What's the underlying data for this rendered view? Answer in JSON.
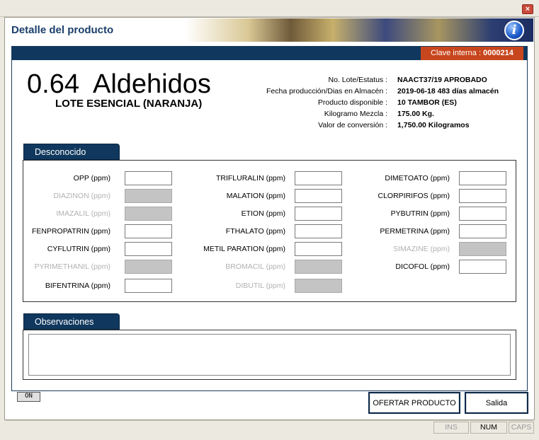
{
  "window": {
    "close_glyph": "×"
  },
  "header": {
    "title": "Detalle del producto",
    "info_icon": "info-icon",
    "info_glyph": "i"
  },
  "clave": {
    "label": "Clave interna :",
    "value": "0000214"
  },
  "product": {
    "name": "0.64  Aldehidos",
    "subtitle": "LOTE ESENCIAL (NARANJA)"
  },
  "info": [
    {
      "label": "No. Lote/Estatus :",
      "value": "NAACT37/19 APROBADO"
    },
    {
      "label": "Fecha producción/Dias en Almacén :",
      "value": "2019-06-18  483 días almacén"
    },
    {
      "label": "Producto disponible :",
      "value": "10 TAMBOR (ES)"
    },
    {
      "label": "Kilogramo Mezcla :",
      "value": "175.00 Kg."
    },
    {
      "label": "Valor de conversión :",
      "value": "1,750.00 Kilogramos"
    }
  ],
  "desconocido": {
    "tab_label": "Desconocido",
    "col1": [
      {
        "label": "OPP (ppm)",
        "value": "",
        "enabled": true
      },
      {
        "label": "DIAZINON (ppm)",
        "value": "",
        "enabled": false
      },
      {
        "label": "IMAZALIL (ppm)",
        "value": "",
        "enabled": false
      },
      {
        "label": "FENPROPATRIN (ppm)",
        "value": "",
        "enabled": true
      },
      {
        "label": "CYFLUTRIN (ppm)",
        "value": "",
        "enabled": true
      },
      {
        "label": "PYRIMETHANIL (ppm)",
        "value": "",
        "enabled": false
      },
      {
        "label": "BIFENTRINA (ppm)",
        "value": "",
        "enabled": true
      }
    ],
    "col2": [
      {
        "label": "TRIFLURALIN (ppm)",
        "value": "",
        "enabled": true
      },
      {
        "label": "MALATION (ppm)",
        "value": "",
        "enabled": true
      },
      {
        "label": "ETION (ppm)",
        "value": "",
        "enabled": true
      },
      {
        "label": "FTHALATO (ppm)",
        "value": "",
        "enabled": true
      },
      {
        "label": "METIL PARATION (ppm)",
        "value": "",
        "enabled": true
      },
      {
        "label": "BROMACIL (ppm)",
        "value": "",
        "enabled": false
      },
      {
        "label": "DIBUTIL (ppm)",
        "value": "",
        "enabled": false
      }
    ],
    "col3": [
      {
        "label": "DIMETOATO (ppm)",
        "value": "",
        "enabled": true
      },
      {
        "label": "CLORPIRIFOS (ppm)",
        "value": "",
        "enabled": true
      },
      {
        "label": "PYBUTRIN (ppm)",
        "value": "",
        "enabled": true
      },
      {
        "label": "PERMETRINA (ppm)",
        "value": "",
        "enabled": true
      },
      {
        "label": "SIMAZINE (ppm)",
        "value": "",
        "enabled": false
      },
      {
        "label": "DICOFOL (ppm)",
        "value": "",
        "enabled": true
      }
    ]
  },
  "observaciones": {
    "tab_label": "Observaciones",
    "value": ""
  },
  "buttons": {
    "small_label": "ON",
    "ofertar_label": "OFERTAR PRODUCTO",
    "salida_label": "Salida"
  },
  "statusbar": {
    "ins": "INS",
    "num": "NUM",
    "caps": "CAPS"
  },
  "colors": {
    "accent_dark": "#10385e",
    "clave_bg": "#c8461d",
    "title_text": "#1b3f6a"
  }
}
